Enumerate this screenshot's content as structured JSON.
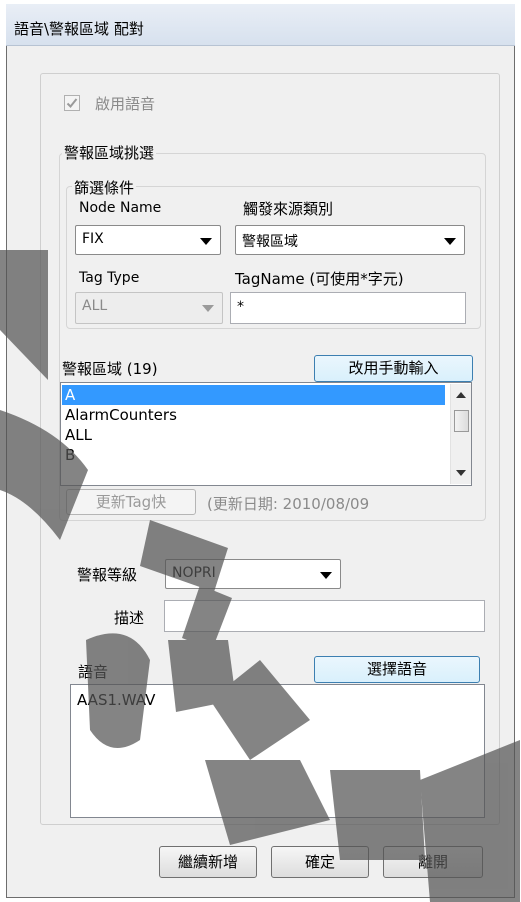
{
  "window": {
    "title": "語音\\警報區域 配對"
  },
  "enable_voice": {
    "checked": true,
    "label": "啟用語音"
  },
  "alarm_area_select": {
    "legend": "警報區域挑選",
    "filter": {
      "legend": "篩選條件",
      "node_name_label": "Node Name",
      "node_name_value": "FIX",
      "source_type_label": "觸發來源類別",
      "source_type_value": "警報區域",
      "tag_type_label": "Tag Type",
      "tag_type_value": "ALL",
      "tagname_label": "TagName (可使用*字元)",
      "tagname_value": "*"
    },
    "list_label": "警報區域 (19)",
    "manual_button": "改用手動輸入",
    "list_items": [
      "A",
      "AlarmCounters",
      "ALL",
      "B"
    ],
    "selected_index": 0,
    "update_button": "更新Tag快",
    "update_date": "(更新日期: 2010/08/09"
  },
  "alarm_level": {
    "label": "警報等級",
    "value": "NOPRI"
  },
  "description": {
    "label": "描述",
    "value": ""
  },
  "voice": {
    "label": "語音",
    "select_button": "選擇語音",
    "files": [
      "AAS1.WAV"
    ]
  },
  "footer": {
    "continue_button": "繼續新增",
    "ok_button": "確定",
    "leave_button": "離開"
  },
  "colors": {
    "selection": "#3399ff",
    "accent_border": "#3c7fb1"
  }
}
